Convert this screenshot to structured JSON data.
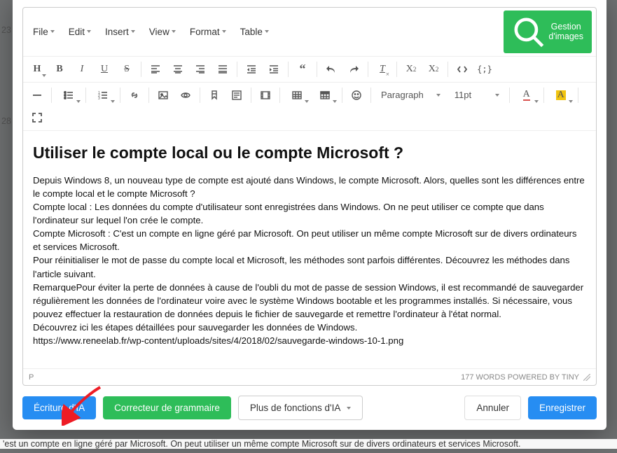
{
  "menubar": {
    "file": "File",
    "edit": "Edit",
    "insert": "Insert",
    "view": "View",
    "format": "Format",
    "table": "Table"
  },
  "image_btn": "Gestion d'images",
  "paragraph_dd": "Paragraph",
  "fontsize_dd": "11pt",
  "content": {
    "heading": "Utiliser le compte local ou le compte Microsoft ?",
    "body": "Depuis Windows 8, un nouveau type de compte est ajouté dans Windows, le compte Microsoft. Alors, quelles sont les différences entre le compte local et le compte Microsoft ?\nCompte local : Les données du compte d'utilisateur sont enregistrées dans Windows. On ne peut utiliser ce compte que dans l'ordinateur sur lequel l'on crée le compte.\nCompte Microsoft : C'est un compte en ligne géré par Microsoft. On peut utiliser un même compte Microsoft sur de divers ordinateurs et services Microsoft.\nPour réinitialiser le mot de passe du compte local et Microsoft, les méthodes sont parfois différentes. Découvrez les méthodes dans l'article suivant.\nRemarquePour éviter la perte de données à cause de l'oubli du mot de passe de session Windows, il est recommandé de sauvegarder régulièrement les données de l'ordinateur voire avec le système Windows bootable et les programmes installés. Si nécessaire, vous pouvez effectuer la restauration de données depuis le fichier de sauvegarde et remettre l'ordinateur à l'état normal.\nDécouvrez ici les étapes détaillées pour sauvegarder les données de Windows.\nhttps://www.reneelab.fr/wp-content/uploads/sites/4/2018/02/sauvegarde-windows-10-1.png"
  },
  "status": {
    "path": "P",
    "words": "177 WORDS POWERED BY TINY"
  },
  "footer": {
    "ai_write": "Écriture d'IA",
    "grammar": "Correcteur de grammaire",
    "more": "Plus de fonctions d'IA",
    "cancel": "Annuler",
    "save": "Enregistrer"
  },
  "bg_below": "'est un compte en ligne géré par Microsoft. On peut utiliser un même compte Microsoft sur de divers ordinateurs et services Microsoft.",
  "bg_left": {
    "n1": "23",
    "n2": "28"
  }
}
